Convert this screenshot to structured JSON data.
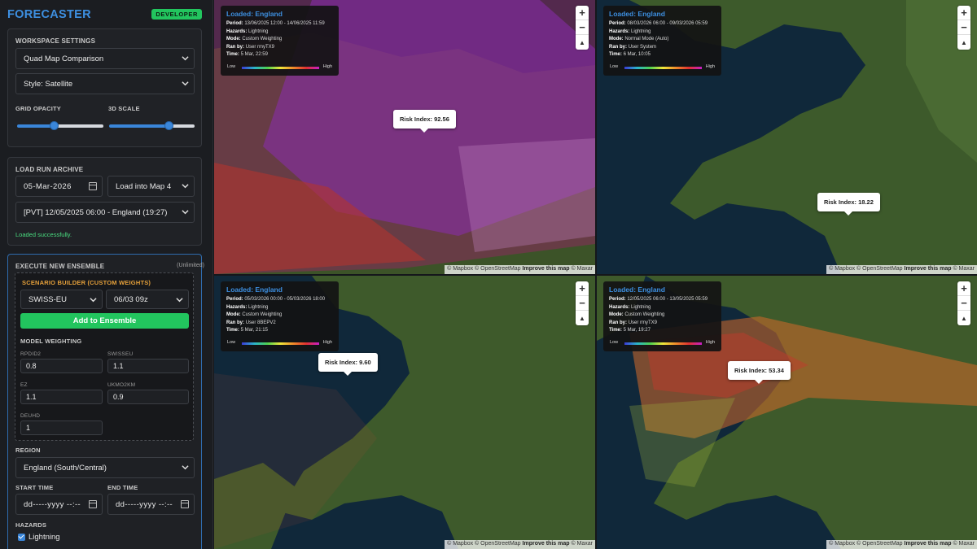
{
  "app": {
    "title": "FORECASTER",
    "badge": "DEVELOPER"
  },
  "workspace": {
    "title": "WORKSPACE SETTINGS",
    "layout_select": "Quad Map Comparison",
    "style_select": "Style: Satellite",
    "grid_opacity_label": "GRID OPACITY",
    "scale_label": "3D SCALE",
    "grid_opacity_value": 0.42,
    "scale_value": 0.72
  },
  "archive": {
    "title": "LOAD RUN ARCHIVE",
    "date": "05-Mar-2026",
    "target_select": "Load into Map 4",
    "run_select": "[PVT] 12/05/2025 06:00 - England (19:27)",
    "status": "Loaded successfully."
  },
  "ensemble": {
    "title": "EXECUTE NEW ENSEMBLE",
    "limit": "(Unlimited)",
    "scenario_title": "SCENARIO BUILDER (CUSTOM WEIGHTS)",
    "model_select": "SWISS-EU",
    "run_select": "06/03 09z",
    "add_button": "Add to Ensemble",
    "weighting_title": "MODEL WEIGHTING",
    "weights": [
      {
        "label": "RPDID2",
        "value": "0.8"
      },
      {
        "label": "SWISSEU",
        "value": "1.1"
      },
      {
        "label": "EZ",
        "value": "1.1"
      },
      {
        "label": "UKMO2KM",
        "value": "0.9"
      },
      {
        "label": "DEUHD",
        "value": "1"
      }
    ],
    "region_label": "REGION",
    "region_select": "England (South/Central)",
    "start_label": "START TIME",
    "end_label": "END TIME",
    "start_placeholder": "dd-----yyyy --:--",
    "end_placeholder": "dd-----yyyy --:--",
    "hazards_label": "HAZARDS",
    "hazard_1": "Lightning",
    "hazard_1_checked": true
  },
  "maps": [
    {
      "loaded": "Loaded: England",
      "period": "13/06/2025 12:00 - 14/06/2025 11:59",
      "hazards": "Lightning",
      "mode": "Custom Weighting",
      "ran_by": "User rmyTX9",
      "time": "5 Mar, 22:59",
      "risk": "Risk Index: 92.56"
    },
    {
      "loaded": "Loaded: England",
      "period": "08/03/2026 06:00 - 09/03/2026 05:59",
      "hazards": "Lightning",
      "mode": "Normal Mode (Auto)",
      "ran_by": "User System",
      "time": "6 Mar, 10:05",
      "risk": "Risk Index: 18.22"
    },
    {
      "loaded": "Loaded: England",
      "period": "05/03/2026 00:00 - 05/03/2026 18:00",
      "hazards": "Lightning",
      "mode": "Custom Weighting",
      "ran_by": "User 8BEPV2",
      "time": "5 Mar, 21:15",
      "risk": "Risk Index: 9.60"
    },
    {
      "loaded": "Loaded: England",
      "period": "12/05/2025 06:00 - 13/05/2025 05:59",
      "hazards": "Lightning",
      "mode": "Custom Weighting",
      "ran_by": "User rmyTX9",
      "time": "5 Mar, 19:27",
      "risk": "Risk Index: 53.34"
    }
  ],
  "map_labels": {
    "period": "Period:",
    "hazards": "Hazards:",
    "mode": "Mode:",
    "ran_by": "Ran by:",
    "time": "Time:",
    "low": "Low",
    "high": "High",
    "zoom_in": "+",
    "zoom_out": "−",
    "compass": "▲",
    "attrib_1": "© Mapbox © OpenStreetMap ",
    "attrib_link": "Improve this map",
    "attrib_2": " © Maxar"
  },
  "colors": {
    "accent": "#3d8fe0",
    "success": "#22c55e",
    "scenario": "#e5a03a",
    "land": "#3f5a2a",
    "sea": "#10293a"
  },
  "icons": [
    "chevron-down-icon",
    "calendar-icon",
    "plus-icon",
    "minus-icon",
    "compass-icon",
    "checkbox-icon"
  ]
}
